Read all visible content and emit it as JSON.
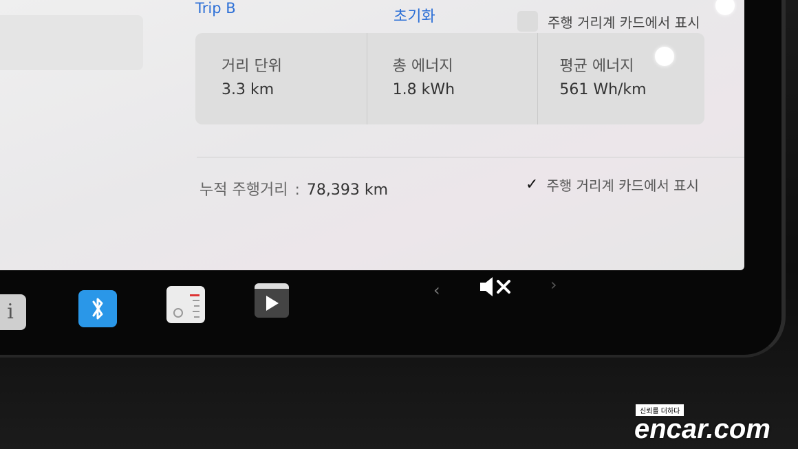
{
  "trip": {
    "title": "Trip B",
    "reset_label": "초기화",
    "show_on_card_label": "주행 거리계 카드에서 표시",
    "stats": [
      {
        "label": "거리 단위",
        "value": "3.3 km"
      },
      {
        "label": "총 에너지",
        "value": "1.8 kWh"
      },
      {
        "label": "평균 에너지",
        "value": "561 Wh/km"
      }
    ]
  },
  "odometer": {
    "label": "누적 주행거리",
    "separator": ":",
    "value": "78,393 km",
    "show_on_card_label": "주행 거리계 카드에서 표시",
    "show_on_card_checked": true
  },
  "dock": {
    "icons": [
      "info-icon",
      "bluetooth-icon",
      "dashcam-icon",
      "theater-icon"
    ],
    "volume": {
      "state": "muted",
      "prev": "‹",
      "next": "›"
    }
  },
  "watermark": {
    "tagline": "신뢰를 더하다",
    "brand": "encar.com"
  },
  "colors": {
    "link": "#2c6fd6",
    "bluetooth": "#2a97e8"
  }
}
